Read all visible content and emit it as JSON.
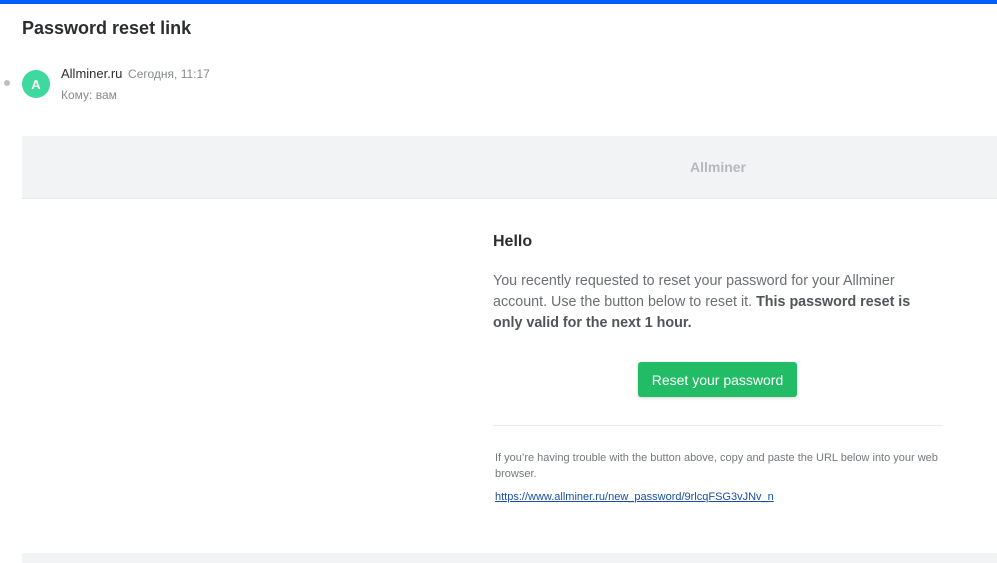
{
  "email": {
    "subject": "Password reset link",
    "sender": {
      "avatar_letter": "A",
      "name": "Allminer.ru",
      "date": "Сегодня, 11:17"
    },
    "recipient": "Кому: вам"
  },
  "body": {
    "brand": "Allminer",
    "greeting": "Hello",
    "message_text": "You recently requested to reset your password for your Allminer account. Use the button below to reset it.",
    "message_bold": "This password reset is only valid for the next 1 hour.",
    "button_label": "Reset your password",
    "trouble_text": "If you’re having trouble with the button above, copy and paste the URL below into your web browser.",
    "link_text": "https://www.allminer.ru/new_password/9rlcqFSG3vJNv_n"
  },
  "colors": {
    "accent_bar": "#005ff9",
    "avatar": "#3dd9a0",
    "button": "#22bc66",
    "link": "#1a4fa8"
  }
}
